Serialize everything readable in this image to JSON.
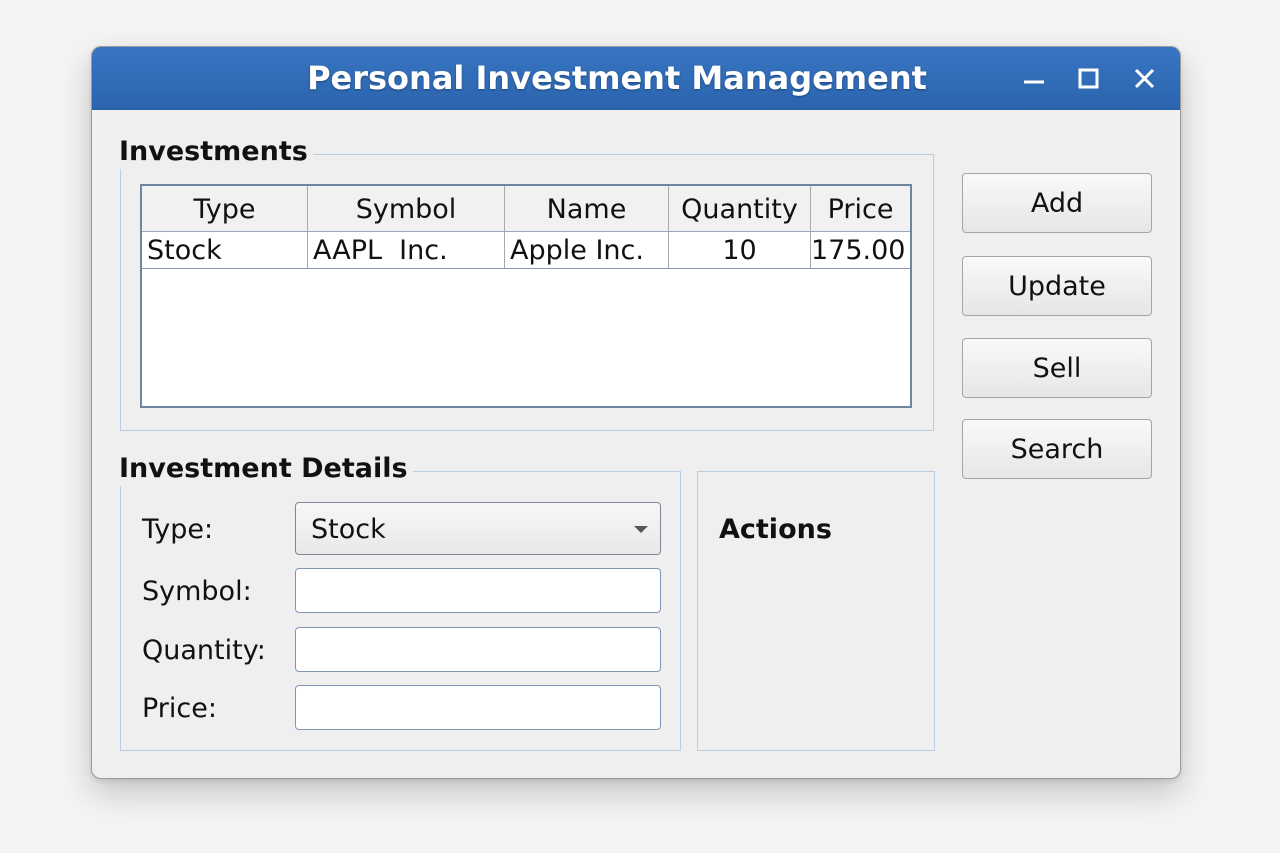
{
  "window": {
    "title": "Personal Investment Management"
  },
  "investments": {
    "legend": "Investments",
    "columns": [
      "Type",
      "Symbol",
      "Name",
      "Quantity",
      "Price"
    ],
    "rows": [
      {
        "type": "Stock",
        "symbol": "AAPL  Inc.",
        "name": "Apple Inc.",
        "quantity": "10",
        "price": "175.00"
      }
    ]
  },
  "side_buttons": {
    "add": "Add",
    "update": "Update",
    "sell": "Sell",
    "search": "Search"
  },
  "details": {
    "legend": "Investment Details",
    "type_label": "Type:",
    "type_value": "Stock",
    "symbol_label": "Symbol:",
    "symbol_value": "",
    "quantity_label": "Quantity:",
    "quantity_value": "",
    "price_label": "Price:",
    "price_value": ""
  },
  "actions": {
    "title": "Actions"
  },
  "icons": {
    "minimize": "minimize-icon",
    "maximize": "maximize-icon",
    "close": "close-icon",
    "dropdown": "chevron-down-icon"
  },
  "colors": {
    "titlebar": "#2f6bb5",
    "border": "#7f96b3"
  }
}
